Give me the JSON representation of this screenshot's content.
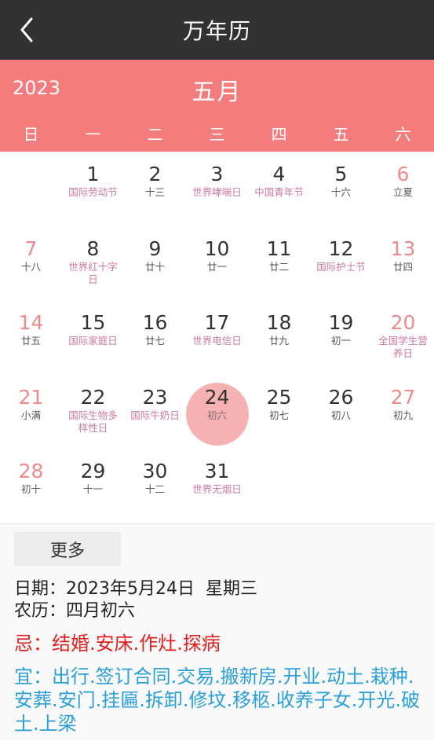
{
  "header": {
    "title": "万年历"
  },
  "month_bar": {
    "year": "2023",
    "month": "五月"
  },
  "weekdays": [
    "日",
    "一",
    "二",
    "三",
    "四",
    "五",
    "六"
  ],
  "days": [
    {
      "day": "",
      "sub": ""
    },
    {
      "day": "1",
      "sub": "国际劳动节",
      "festival": true
    },
    {
      "day": "2",
      "sub": "十三"
    },
    {
      "day": "3",
      "sub": "世界哮喘日",
      "festival": true
    },
    {
      "day": "4",
      "sub": "中国青年节",
      "festival": true
    },
    {
      "day": "5",
      "sub": "十六"
    },
    {
      "day": "6",
      "sub": "立夏"
    },
    {
      "day": "7",
      "sub": "十八"
    },
    {
      "day": "8",
      "sub": "世界红十字日",
      "festival": true
    },
    {
      "day": "9",
      "sub": "廿十"
    },
    {
      "day": "10",
      "sub": "廿一"
    },
    {
      "day": "11",
      "sub": "廿二"
    },
    {
      "day": "12",
      "sub": "国际护士节",
      "festival": true
    },
    {
      "day": "13",
      "sub": "廿四"
    },
    {
      "day": "14",
      "sub": "廿五"
    },
    {
      "day": "15",
      "sub": "国际家庭日",
      "festival": true
    },
    {
      "day": "16",
      "sub": "廿七"
    },
    {
      "day": "17",
      "sub": "世界电信日",
      "festival": true
    },
    {
      "day": "18",
      "sub": "廿九"
    },
    {
      "day": "19",
      "sub": "初一"
    },
    {
      "day": "20",
      "sub": "全国学生营养日",
      "festival": true
    },
    {
      "day": "21",
      "sub": "小满"
    },
    {
      "day": "22",
      "sub": "国际生物多样性日",
      "festival": true
    },
    {
      "day": "23",
      "sub": "国际牛奶日",
      "festival": true
    },
    {
      "day": "24",
      "sub": "初六",
      "today": true
    },
    {
      "day": "25",
      "sub": "初七"
    },
    {
      "day": "26",
      "sub": "初八"
    },
    {
      "day": "27",
      "sub": "初九"
    },
    {
      "day": "28",
      "sub": "初十"
    },
    {
      "day": "29",
      "sub": "十一"
    },
    {
      "day": "30",
      "sub": "十二"
    },
    {
      "day": "31",
      "sub": "世界无烟日",
      "festival": true
    },
    {
      "day": "",
      "sub": ""
    },
    {
      "day": "",
      "sub": ""
    },
    {
      "day": "",
      "sub": ""
    }
  ],
  "more_label": "更多",
  "info": {
    "date_line": "日期：2023年5月24日  星期三",
    "lunar_line": "农历：四月初六",
    "avoid_line": "忌：结婚.安床.作灶.探病",
    "suit_line": "宜：出行.签订合同.交易.搬新房.开业.动土.栽种.安葬.安门.挂匾.拆卸.修坟.移柩.收养子女.开光.破土.上梁"
  },
  "colors": {
    "titlebar": "#323232",
    "accent": "#f47c7c",
    "today_circle": "#f6b2b2",
    "weekend": "#ef8a8a",
    "festival": "#c9799e",
    "avoid": "#e0201f",
    "suit": "#2a9fd8"
  }
}
